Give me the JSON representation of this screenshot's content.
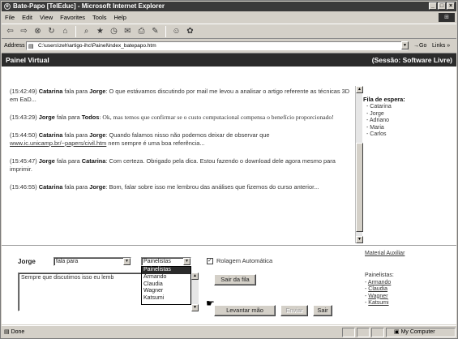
{
  "window": {
    "title": "Bate-Papo [TelEduc] - Microsoft Internet Explorer",
    "buttons": [
      "_",
      "□",
      "×"
    ],
    "brand_logo": "IE"
  },
  "menubar": {
    "items": [
      "File",
      "Edit",
      "View",
      "Favorites",
      "Tools",
      "Help"
    ]
  },
  "toolbar": {
    "icons": [
      "back-icon",
      "forward-icon",
      "stop-icon",
      "refresh-icon",
      "home-icon",
      "search-icon",
      "favorites-icon",
      "history-icon",
      "mail-icon",
      "print-icon",
      "edit-icon",
      "discuss-icon",
      "messenger-icon"
    ]
  },
  "address": {
    "label": "Address",
    "value": "C:\\users\\zeh\\artigo-ihc\\Painel\\index_batepapo.htm",
    "go": "Go",
    "links": "Links »"
  },
  "panel": {
    "title": "Painel Virtual",
    "session": "(Sessão: Software Livre)"
  },
  "messages": [
    {
      "time": "(15:42:49)",
      "from": "Catarina",
      "verb": "fala para",
      "to": "Jorge",
      "text": ": O que estávamos discutindo por mail me levou a analisar o artigo referente as técnicas 3D em EaD..."
    },
    {
      "time": "(15:43:29)",
      "from": "Jorge",
      "verb": "fala para",
      "to": "Todos",
      "text": ": Ok, mas temos que confirmar se o custo computacional compensa o benefício proporcionado!"
    },
    {
      "time": "(15:44:50)",
      "from": "Catarina",
      "verb": "fala para",
      "to": "Jorge",
      "text_pre": ": Quando falamos nisso não podemos deixar de observar que ",
      "link": "www.ic.unicamp.br/~papers/civil.htm",
      "text_post": " nem sempre é uma boa referência..."
    },
    {
      "time": "(15:45:47)",
      "from": "Jorge",
      "verb": "fala para",
      "to": "Catarina",
      "text": ": Com certeza. Obrigado pela dica. Estou fazendo o download dele agora mesmo para imprimir."
    },
    {
      "time": "(15:46:55)",
      "from": "Catarina",
      "verb": "fala para",
      "to": "Jorge",
      "text": ": Bom, falar sobre isso me lembrou das análises que fizemos do curso anterior..."
    }
  ],
  "queue": {
    "heading": "Fila de espera:",
    "items": [
      "- Catarina",
      "- Jorge",
      "- Adriano",
      "- Maria",
      "- Carlos"
    ]
  },
  "material_link": "Material Auxiliar",
  "painelistas": {
    "heading": "Painelistas:",
    "items": [
      "Armando",
      "Claudia",
      "Wagner",
      "Katsumi"
    ]
  },
  "form": {
    "user": "Jorge",
    "mode_select": "fala para",
    "target_select": "Painelistas",
    "target_options": [
      "Painelistas",
      "Armando",
      "Claudia",
      "Wagner",
      "Katsumi"
    ],
    "auto_scroll_label": "Rolagem Automática",
    "auto_scroll_checked": true,
    "message_value": "Sempre que discutimos isso eu lemb",
    "exit_room": "Sair da fila",
    "raise_hand": "Levantar mão",
    "send": "Enviar",
    "quit": "Sair"
  },
  "status": {
    "text": "Done",
    "zone": "My Computer"
  }
}
